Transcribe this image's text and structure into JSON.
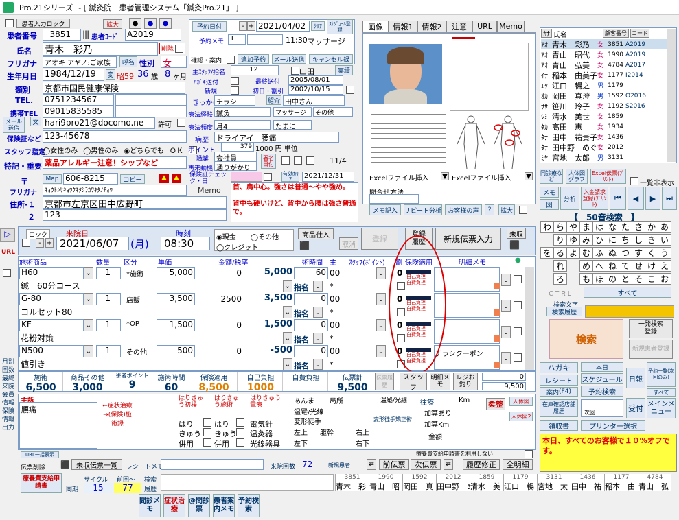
{
  "titlebar": {
    "app": "Pro.21シリーズ",
    "title": "- [ 鍼灸院　患者管理システム「鍼灸Pro.21」 ]"
  },
  "top": {
    "lock": "患者入力ロック",
    "expand": "拡大"
  },
  "patient": {
    "id_label": "患者番号",
    "id": "3851",
    "code_label": "患者ｺｰﾄﾞ",
    "code": "A2019",
    "name_label": "氏名",
    "name": "青木　彩乃",
    "delete": "削除",
    "kana_label": "フリガナ",
    "kana": "アオキ アヤノ:ご家族",
    "honorific": "呼名",
    "sex_label": "性別",
    "sex": "女",
    "birth_label": "生年月日",
    "birth": "1984/12/19",
    "era": "昭59",
    "age": "36",
    "age_unit": "歳",
    "months": "8",
    "months_unit": "ヶ月",
    "category_label": "類別",
    "category": "京都市国民健康保険",
    "tel_label": "TEL.",
    "tel": "0751234567",
    "mobile_label": "携帯TEL",
    "mobile": "09015835585",
    "mail_btn": "メール送信",
    "mail_icon": "文",
    "email": "hari9pro21@docomo.ne",
    "permit": "許可",
    "insurance_label": "保険証など",
    "insurance": "123-45678",
    "staff_label": "スタッフ指定",
    "staff_opts": [
      "女性のみ",
      "男性のみ",
      "どちらでも"
    ],
    "staff_any": "ＯＫ",
    "special_label": "特記・重要",
    "special": "薬品アレルギー注意！シップなど",
    "zip_label": "〒",
    "map": "Map",
    "zip": "606-8215",
    "copy": "コピー",
    "addr_kana_label": "フリガナ",
    "addr_kana": "ｷｮｳﾄｼｻｷｮｳｸｷﾀｼﾗｶﾜｷﾀﾉﾁｮｳ",
    "addr_label": "住所-１",
    "addr1": "京都市左京区田中広野町",
    "addr2_label": "２",
    "addr2": "123",
    "memo_label": "Memo",
    "memo": "首、肩中心。強さは普通～やや強め。\n\n背中も硬いけど、背中から腰は強さ普通で。"
  },
  "appt": {
    "btn": "予約日付",
    "date": "2021/04/02",
    "clear": "ｸﾘｱ",
    "schedule": "ｽｹｼﾞｭｰﾙ登録",
    "memo_label": "予約メモ",
    "memo_n": "1",
    "time": "11:30",
    "course": "マッサージ",
    "confirm": "確認・案内",
    "add": "追加予約",
    "mail": "メール送信",
    "cancel": "キャンセル録"
  },
  "mid": {
    "master_label": "主ｽﾀｯﾌ/指名",
    "master": "12",
    "master_name": "山田",
    "jisseki": "実績",
    "hagaki_label": "ﾊｶﾞｷ送付",
    "last_label": "最終送付",
    "last": "2005/08/01",
    "new_label": "新規",
    "first_label": "初日・割引",
    "first": "2002/10/15",
    "trigger_label": "きっかけ",
    "trigger": "チラシ",
    "intro": "紹介",
    "intro_name": "田中さん",
    "hist_label": "療法経験",
    "hist": "鍼灸",
    "hist2": "マッサージ",
    "hist3": "その他",
    "freq_label": "療法頻度",
    "freq": "月4",
    "freq2": "たまに",
    "disease_label": "病歴",
    "disease": "ドライアイ　腰痛",
    "point_label": "ポイント",
    "point": "379",
    "unit": "1000 円 単位",
    "job_label": "職業",
    "job": "会社員",
    "revisit_label": "再来動機",
    "revisit": "通りがかり",
    "ins_label": "保険証チェック・日",
    "name_check": "署名日付",
    "period": "有効ｶﾘｱ",
    "check_date": "11/4",
    "expiry": "2021/12/31"
  },
  "tabs": [
    "画像",
    "情報1",
    "情報2",
    "注意",
    "URL",
    "Memo"
  ],
  "excel": [
    "Excelファイル挿入",
    "Excelファイル挿入"
  ],
  "inquiry": {
    "label": "問合せ方法",
    "memo": "メモ記入",
    "repeat": "リピート分析",
    "customer": "お客様の声",
    "q": "?",
    "expand": "拡大"
  },
  "patlist": {
    "headers": [
      "ｶﾅ",
      "氏名",
      "顧客番号",
      "コード"
    ],
    "rows": [
      {
        "kana": "ｱｵ",
        "name": "青木　彩乃",
        "sex": "女",
        "no": "3851",
        "code": "A2019"
      },
      {
        "kana": "ｱｵ",
        "name": "青山　昭代",
        "sex": "女",
        "no": "1990",
        "code": "A2019"
      },
      {
        "kana": "ｱｵ",
        "name": "青山　弘美",
        "sex": "女",
        "no": "4784",
        "code": "A2017"
      },
      {
        "kana": "ｲﾅ",
        "name": "稲本　由美子",
        "sex": "女",
        "no": "1177",
        "code": "I2014"
      },
      {
        "kana": "ｴｸ",
        "name": "江口　暢之",
        "sex": "男",
        "no": "1179",
        "code": ""
      },
      {
        "kana": "ｵｶ",
        "name": "岡田　真澄",
        "sex": "男",
        "no": "1592",
        "code": "O2016"
      },
      {
        "kana": "ｻｻ",
        "name": "笹川　玲子",
        "sex": "女",
        "no": "1192",
        "code": "S2016"
      },
      {
        "kana": "ｼﾐ",
        "name": "清水　美世",
        "sex": "女",
        "no": "1859",
        "code": ""
      },
      {
        "kana": "ﾀｶ",
        "name": "高田　恵",
        "sex": "女",
        "no": "1934",
        "code": ""
      },
      {
        "kana": "ﾀﾅ",
        "name": "田中　祐貴子",
        "sex": "女",
        "no": "1436",
        "code": ""
      },
      {
        "kana": "ﾀﾅ",
        "name": "田中野　めぐみ",
        "sex": "女",
        "no": "2012",
        "code": ""
      },
      {
        "kana": "ﾐﾔ",
        "name": "宮地　太郎",
        "sex": "男",
        "no": "3131",
        "code": ""
      }
    ]
  },
  "side_btns": {
    "appt_other": "同診療など",
    "person_graph": "人体図グラフ",
    "excel": "Excel伝票(ﾌﾟﾘﾝﾄ)",
    "list_hide": "一覧非表示",
    "memo": "メモ",
    "analysis": "分析",
    "enter": "入金請求登録(ﾌﾟﾘﾝﾄ)",
    "zu": "図",
    "search50": "【　50音検索　】",
    "ctrl": "ＣＴＲＬ",
    "all": "すべて",
    "search_text": "検索文字",
    "history": "検索履歴",
    "search": "検索",
    "quick": "一発検索",
    "quick2": "登録",
    "new_pat": "新規患者登録"
  },
  "kana50": [
    [
      "わ",
      "ら",
      "や",
      "ま",
      "は",
      "な",
      "た",
      "さ",
      "か",
      "あ"
    ],
    [
      "",
      "り",
      "ゆ",
      "み",
      "ひ",
      "に",
      "ち",
      "し",
      "き",
      "い"
    ],
    [
      "を",
      "る",
      "よ",
      "む",
      "ふ",
      "ぬ",
      "つ",
      "す",
      "く",
      "う"
    ],
    [
      "",
      "れ",
      "",
      "め",
      "へ",
      "ね",
      "て",
      "せ",
      "け",
      "え"
    ],
    [
      "",
      "ろ",
      "",
      "も",
      "ほ",
      "の",
      "と",
      "そ",
      "こ",
      "お"
    ]
  ],
  "visit": {
    "lock": "ロック",
    "date_label": "来院日",
    "date": "2021/06/07",
    "dow": "(月)",
    "time_label": "時刻",
    "time": "08:30",
    "cash": "現金",
    "credit": "クレジット",
    "other": "その他",
    "goods": "商品仕入",
    "reg": "登録",
    "register": "登録",
    "history": "履歴",
    "cancel": "取消",
    "new_slip": "新規伝票入力",
    "unpaid": "未収"
  },
  "table": {
    "headers": [
      "施術商品",
      "数量",
      "区分",
      "単価",
      "金額/税率",
      "術時間",
      "主",
      "ｽﾀｯﾌ(ﾎﾟｲﾝﾄ)",
      "割",
      "保険適用",
      "明細メモ"
    ],
    "rows": [
      {
        "code": "H60",
        "name": "鍼　60分コース",
        "qty": "1",
        "kubun": "*施術",
        "price": "5,000",
        "amt1": "0",
        "amt": "5,000",
        "time": "60",
        "staff": "00",
        "s2": "0",
        "s3": "",
        "memo": ""
      },
      {
        "code": "G-80",
        "name": "コルセット80",
        "qty": "1",
        "kubun": "店販",
        "price": "3,500",
        "amt1": "2500",
        "amt": "3,500",
        "time": "0",
        "staff": "00",
        "s2": "0",
        "s3": "",
        "memo": ""
      },
      {
        "code": "KF",
        "name": "花粉対策",
        "qty": "1",
        "kubun": "*OP",
        "price": "1,500",
        "amt1": "0",
        "amt": "1,500",
        "time": "0",
        "staff": "00",
        "s2": "0",
        "s3": "",
        "memo": ""
      },
      {
        "code": "N500",
        "name": "値引き",
        "qty": "1",
        "kubun": "その他",
        "price": "-500",
        "amt1": "0",
        "amt": "-500",
        "time": "0",
        "staff": "00",
        "s2": "0",
        "s3": "",
        "memo": "チラシクーポン"
      }
    ],
    "shimei": "指名",
    "star": "*",
    "ins1": "自己負担",
    "ins2": "自費負担"
  },
  "totals": {
    "labels": [
      "施術",
      "商品その他",
      "患者ポイント",
      "施術時間",
      "保険適用",
      "自己負担",
      "自費負担",
      "伝票計"
    ],
    "values": [
      "6,500",
      "3,000",
      "9",
      "60",
      "8,500",
      "1000",
      "",
      "9,500"
    ],
    "slip": "伝票履歴",
    "staff": "スタッフ",
    "meisai": "明細メモ",
    "register": "レジお釣り",
    "change_top": "0",
    "change": "9,500"
  },
  "complaint": {
    "label": "主訴",
    "text": "腰痛",
    "arrows": "←症状治療→(保険)施術録",
    "harikyu1": "はりきゅう初検",
    "harikyu2": "はりきゅう施術",
    "harikyu3": "はりきゅう電療",
    "hari": "はり",
    "kyu": "きゅう",
    "heiyo": "併用",
    "denki": "電気針",
    "onkyu": "温灸器",
    "kousen": "光線器具",
    "anma": "あんま",
    "kyokusho": "局所",
    "onshippu": "温罨/光線",
    "henkei": "変形徒手",
    "left_up": "左上",
    "left_down": "左下",
    "kubi": "躯幹",
    "right_up": "右上",
    "right_down": "右下",
    "onan": "温罨/光線",
    "henkei2": "変形徒手矯正術",
    "oufuku": "往療",
    "km": "Km",
    "kasan": "加算あり",
    "kasan_km": "加算Km",
    "kingaku": "金額",
    "yoshiki": "柔整",
    "body1": "人体図",
    "body2": "人体図2"
  },
  "bottom": {
    "url": "URL一括表示",
    "slip_del": "伝票削除",
    "unpaid_list": "未収伝票一覧",
    "receipt": "レシートメモ",
    "visits_label": "来院回数",
    "visits": "72",
    "new": "新規患者",
    "prev": "前伝票",
    "next": "次伝票",
    "fix": "履歴修正",
    "all": "全明細",
    "notice": "療養費支給申請書を利用しない",
    "seiryo": "療養費支給申請書",
    "cycle": "サイクル",
    "cycle_v": "15",
    "prev_label": "前回〜",
    "prev_v": "77",
    "search": "検索",
    "hist": "履歴",
    "same": "同期"
  },
  "actions": [
    "問診メモ",
    "症状治療",
    "@問診票",
    "患者案内メモ",
    "予約検索"
  ],
  "history_strip": [
    {
      "no": "3851",
      "name": "青木　彩"
    },
    {
      "no": "1990",
      "name": "青山　昭"
    },
    {
      "no": "1592",
      "name": "岡田　真"
    },
    {
      "no": "2012",
      "name": "田中野　め"
    },
    {
      "no": "1859",
      "name": "清水　美"
    },
    {
      "no": "1179",
      "name": "江口　暢"
    },
    {
      "no": "3131",
      "name": "宮地　太"
    },
    {
      "no": "1436",
      "name": "田中　祐"
    },
    {
      "no": "1177",
      "name": "稲本　由"
    },
    {
      "no": "4784",
      "name": "青山　弘"
    }
  ],
  "right_bottom": {
    "hagaki": "ハガキ",
    "honjitsu": "本日",
    "receipt": "レシート",
    "schedule": "スケジュール",
    "nippo": "日報",
    "yoyaku_list": "予約一覧(次回のみ)",
    "annai": "案内",
    "f4": "(F4)",
    "yoyaku_search": "予約検索",
    "subete": "すべて",
    "zaiko": "在庫確認店舗履歴",
    "next_day": "次回",
    "uketsuke": "受付",
    "main_menu": "メインメニュー",
    "ryoshusho": "領収書",
    "printer": "プリンター選択",
    "notice": "本日、すべてのお客様で１０%オフです。"
  },
  "left_side": [
    "月別",
    "回数",
    "最終",
    "来院",
    "会員",
    "情報",
    "保険",
    "情報",
    "出力"
  ]
}
